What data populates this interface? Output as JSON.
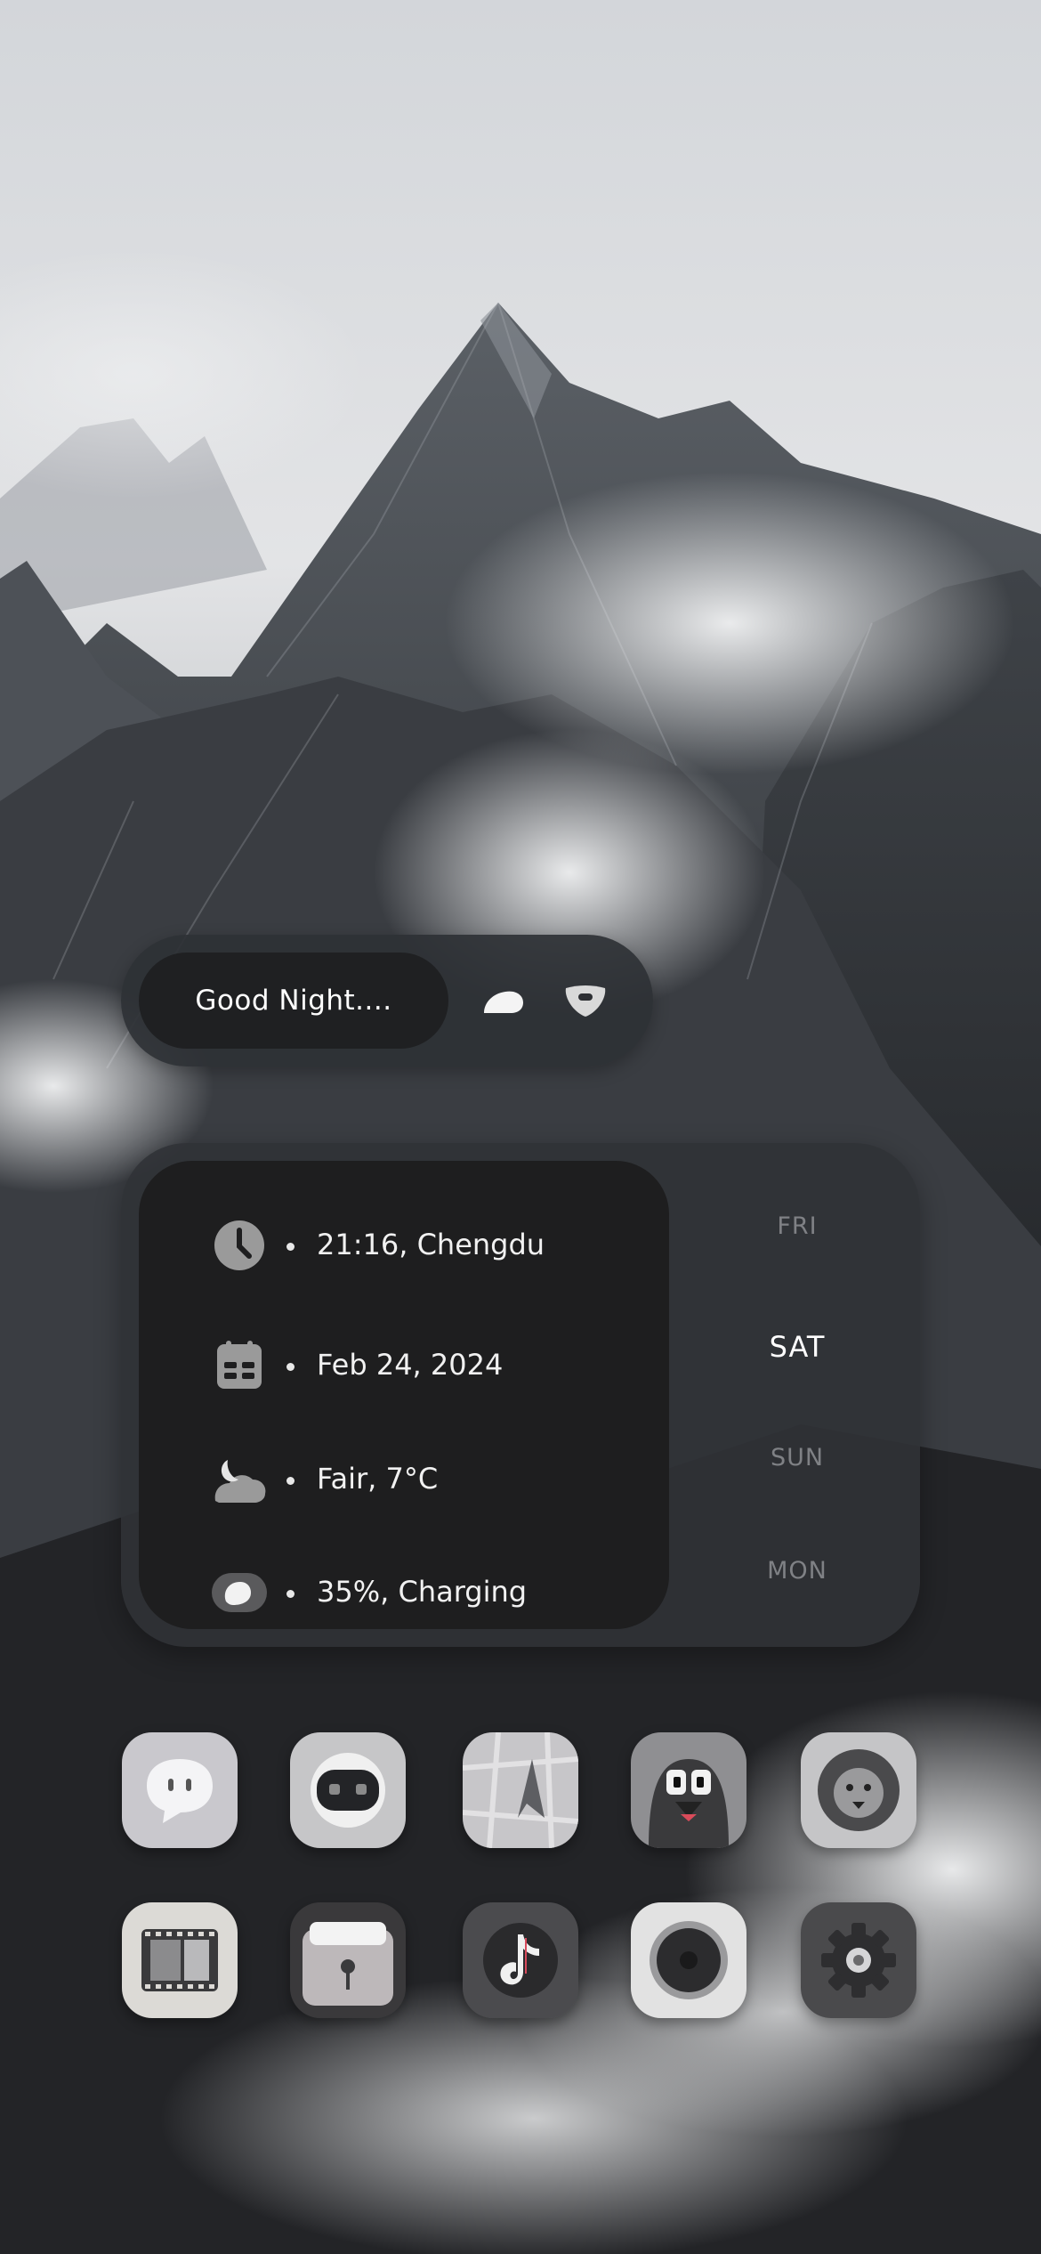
{
  "greeting": {
    "text": "Good Night...."
  },
  "info_widget": {
    "rows": [
      {
        "icon": "clock-icon",
        "text": "21:16, Chengdu"
      },
      {
        "icon": "calendar-icon",
        "text": "Feb 24, 2024"
      },
      {
        "icon": "moon-cloud-icon",
        "text": "Fair, 7°C"
      },
      {
        "icon": "battery-icon",
        "text": "35%, Charging"
      }
    ],
    "days": [
      "FRI",
      "SAT",
      "SUN",
      "MON"
    ],
    "active_day": "SAT"
  },
  "apps": [
    {
      "icon": "chat-bubble-icon"
    },
    {
      "icon": "robot-face-icon"
    },
    {
      "icon": "map-navigation-icon"
    },
    {
      "icon": "crow-mascot-icon"
    },
    {
      "icon": "lion-icon"
    },
    {
      "icon": "film-strip-icon"
    },
    {
      "icon": "wallet-icon"
    },
    {
      "icon": "tiktok-icon"
    },
    {
      "icon": "speaker-icon"
    },
    {
      "icon": "settings-gear-icon"
    }
  ],
  "colors": {
    "widget_bg": "#303236",
    "widget_inner": "#1e1e1f",
    "text_primary": "#ffffff",
    "text_dim": "#7f8185"
  }
}
